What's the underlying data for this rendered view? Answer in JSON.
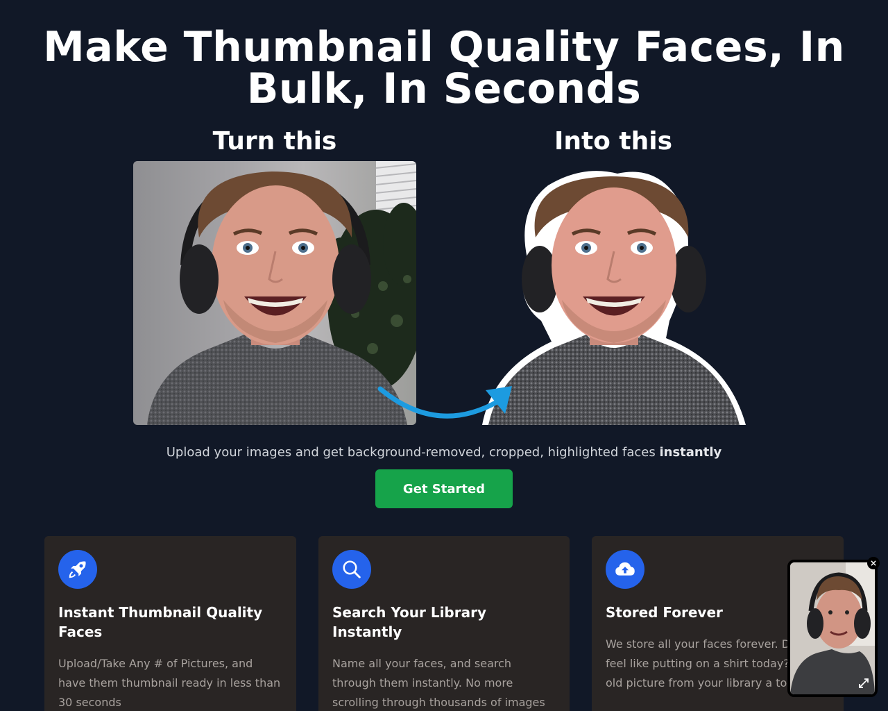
{
  "hero": {
    "title": "Make Thumbnail Quality Faces, In Bulk, In Seconds",
    "before_heading": "Turn this",
    "after_heading": "Into this",
    "subtitle_text": "Upload your images and get background-removed, cropped, highlighted faces ",
    "subtitle_emphasis": "instantly",
    "cta_label": "Get Started"
  },
  "features": [
    {
      "icon": "rocket-icon",
      "title": "Instant Thumbnail Quality Faces",
      "text": "Upload/Take Any # of Pictures, and have them thumbnail ready in less than 30 seconds"
    },
    {
      "icon": "search-icon",
      "title": "Search Your Library Instantly",
      "text": "Name all your faces, and search through them instantly. No more scrolling through thousands of images"
    },
    {
      "icon": "cloud-upload-icon",
      "title": "Stored Forever",
      "text": "We store all your faces forever. Don't feel like putting on a shirt today? Put an old picture from your library a to work."
    }
  ],
  "video_widget": {
    "close_label": "×"
  },
  "colors": {
    "background": "#111827",
    "card": "#292524",
    "accent_green": "#16a34a",
    "icon_blue": "#2563eb",
    "arrow_blue": "#1d9be0"
  }
}
